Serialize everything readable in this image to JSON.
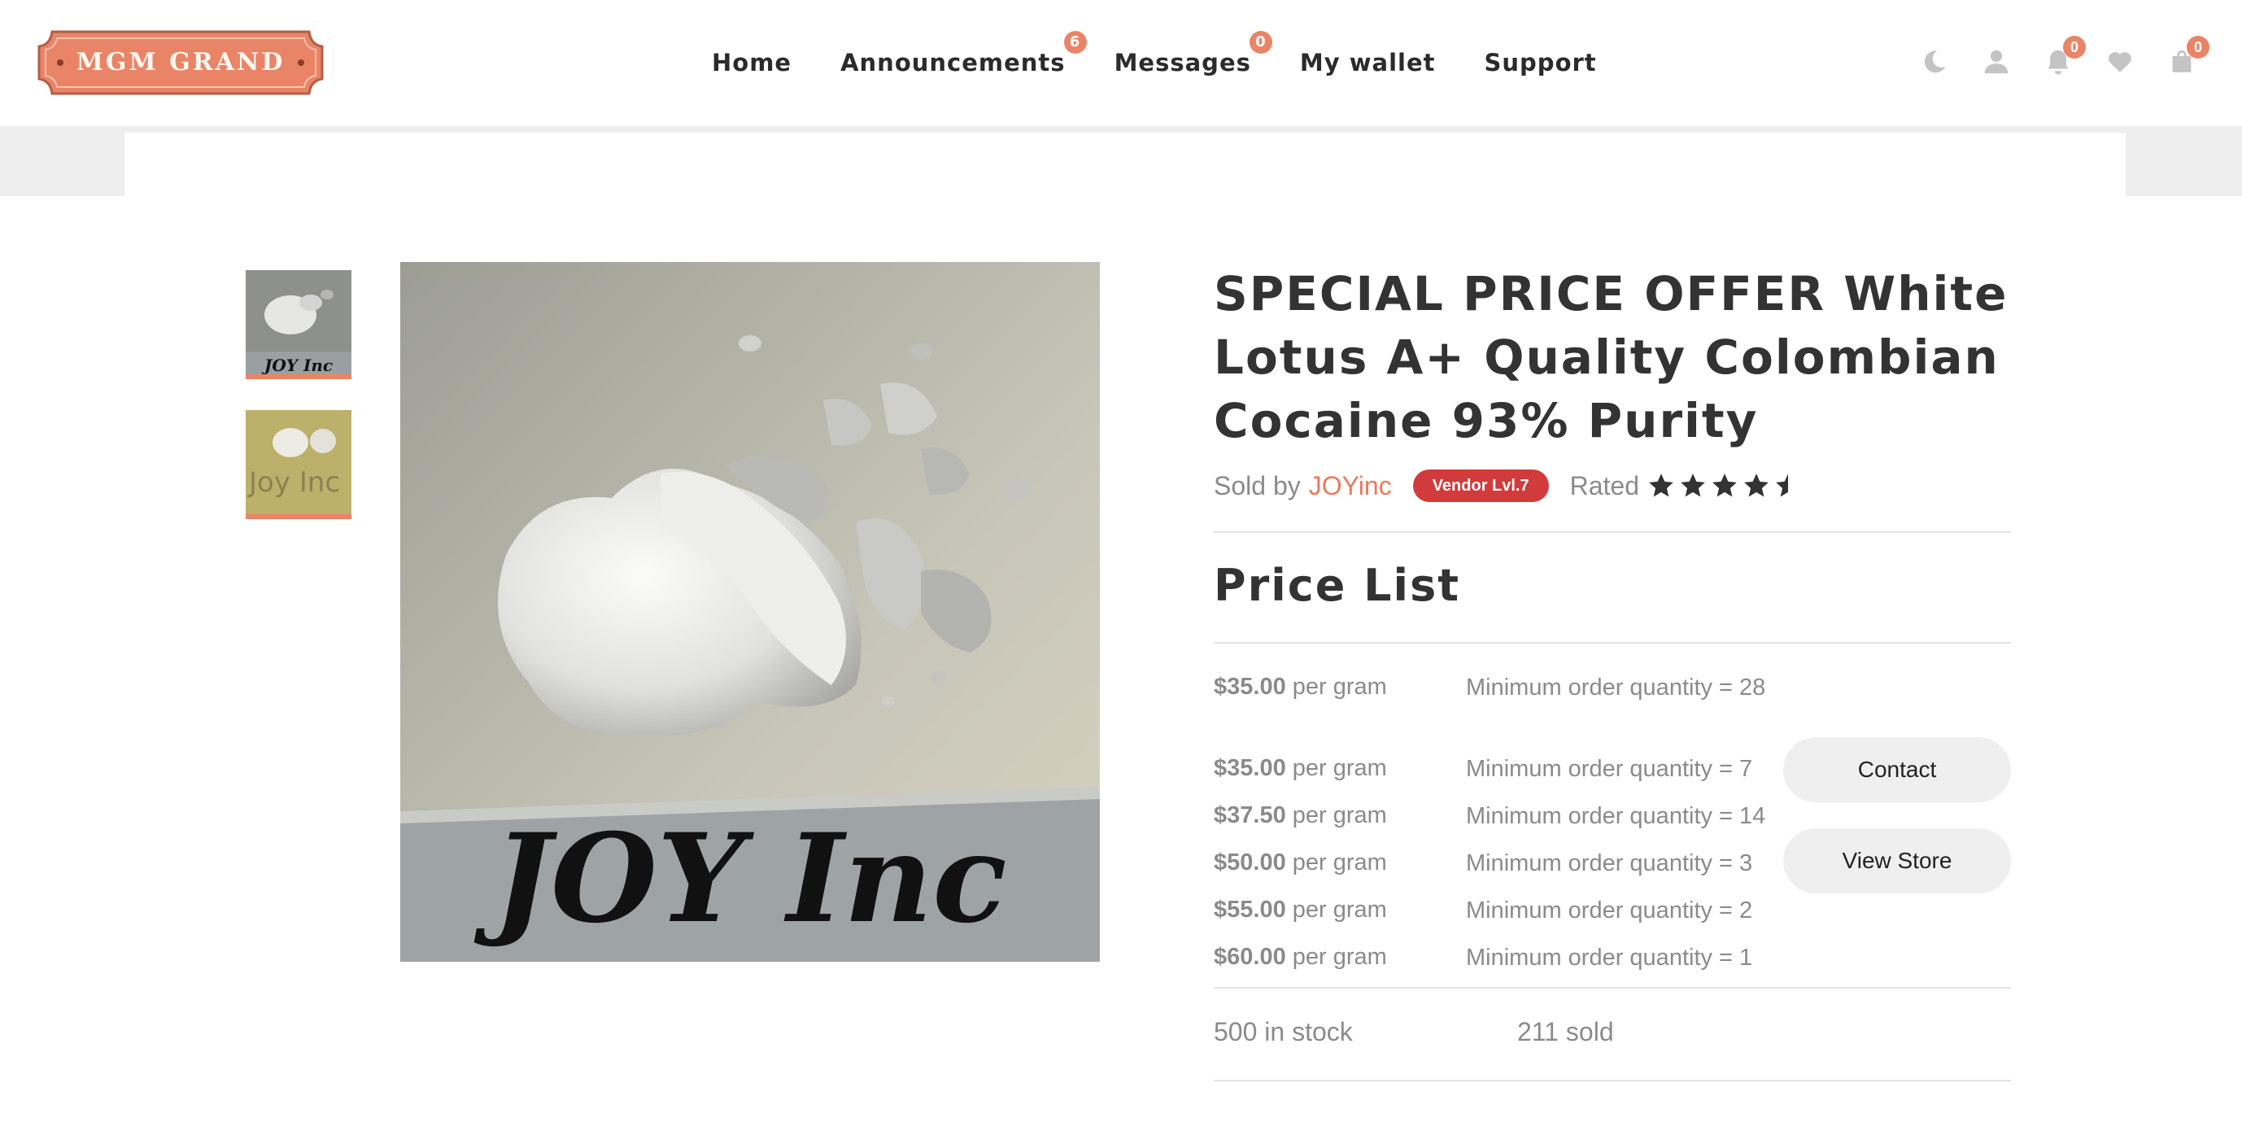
{
  "brand": {
    "logo_text": "MGM GRAND",
    "accent_color": "#ea8466"
  },
  "nav": {
    "items": [
      {
        "label": "Home",
        "badge": ""
      },
      {
        "label": "Announcements",
        "badge": "6"
      },
      {
        "label": "Messages",
        "badge": "0"
      },
      {
        "label": "My wallet",
        "badge": ""
      },
      {
        "label": "Support",
        "badge": ""
      }
    ]
  },
  "header_icons": {
    "theme": {
      "icon": "moon-icon"
    },
    "account": {
      "icon": "user-icon"
    },
    "notifications": {
      "icon": "bell-icon",
      "badge": "0"
    },
    "wishlist": {
      "icon": "heart-icon"
    },
    "cart": {
      "icon": "bag-icon",
      "badge": "0"
    }
  },
  "product": {
    "title": "SPECIAL PRICE OFFER White Lotus A+ Quality Colombian Cocaine 93% Purity",
    "sold_by_label": "Sold by",
    "seller": "JOYinc",
    "vendor_badge": "Vendor Lvl.7",
    "rated_label": "Rated",
    "rating": 4.5,
    "image_caption": "JOY Inc",
    "thumbnails": [
      {
        "icon": "product-photo-thumbnail",
        "caption": "JOY Inc"
      },
      {
        "icon": "product-photo-thumbnail",
        "caption": "Joy Inc"
      }
    ]
  },
  "price_list": {
    "heading": "Price List",
    "rows": [
      {
        "price": "$35.00",
        "unit": "per gram",
        "moq": "Minimum order quantity = 28"
      },
      {
        "price": "$35.00",
        "unit": "per gram",
        "moq": "Minimum order quantity = 7"
      },
      {
        "price": "$37.50",
        "unit": "per gram",
        "moq": "Minimum order quantity = 14"
      },
      {
        "price": "$50.00",
        "unit": "per gram",
        "moq": "Minimum order quantity = 3"
      },
      {
        "price": "$55.00",
        "unit": "per gram",
        "moq": "Minimum order quantity = 2"
      },
      {
        "price": "$60.00",
        "unit": "per gram",
        "moq": "Minimum order quantity = 1"
      }
    ]
  },
  "actions": {
    "contact": "Contact",
    "view_store": "View Store"
  },
  "inventory": {
    "stock": "500 in stock",
    "sold": "211 sold"
  }
}
